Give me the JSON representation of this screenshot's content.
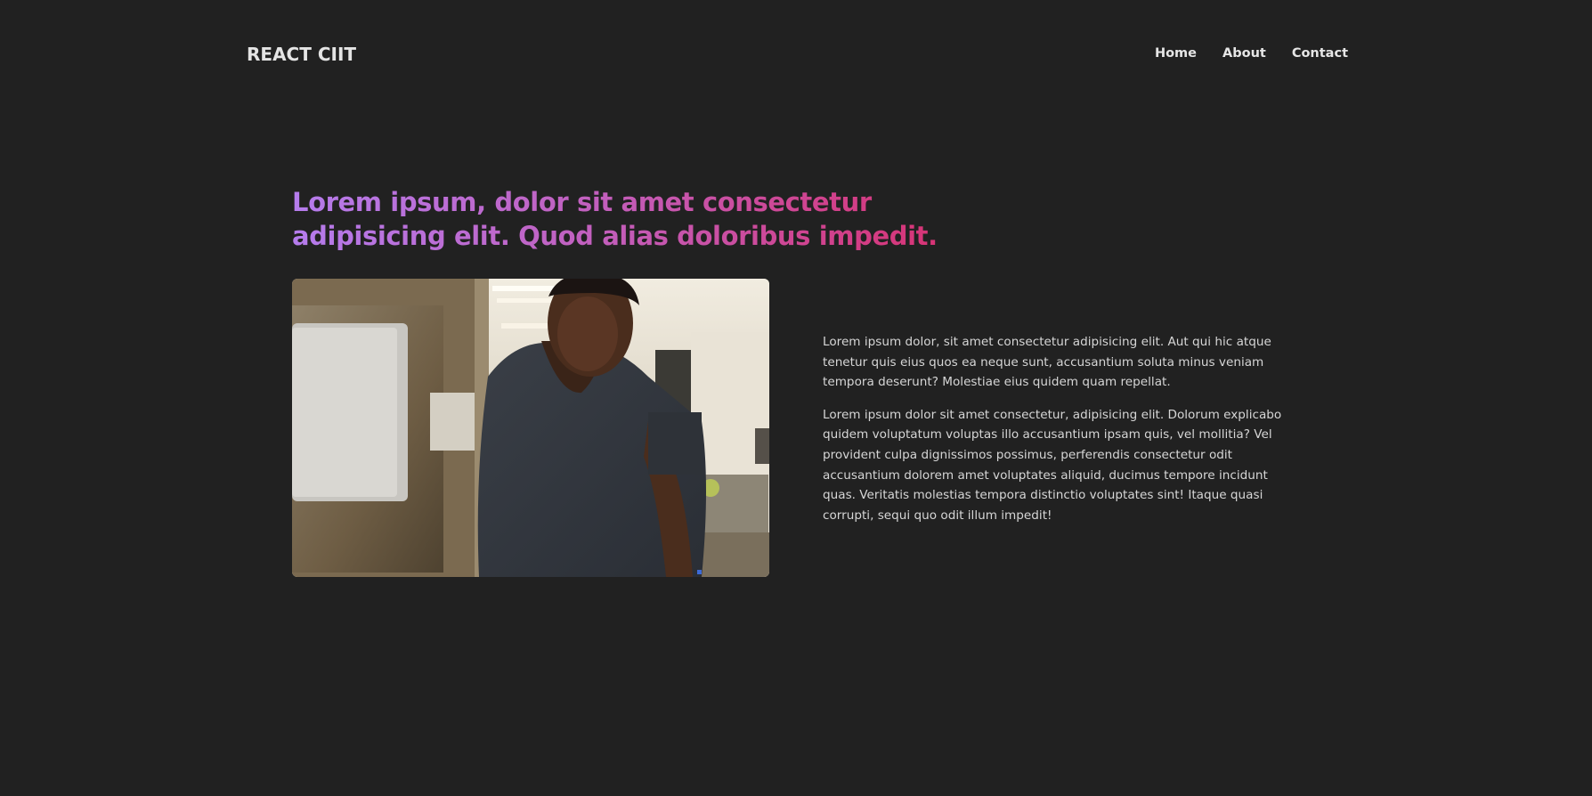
{
  "header": {
    "brand": "REACT CIIT",
    "nav": [
      {
        "label": "Home"
      },
      {
        "label": "About"
      },
      {
        "label": "Contact"
      }
    ]
  },
  "hero": {
    "headline": "Lorem ipsum, dolor sit amet consectetur adipisicing elit. Quod alias doloribus impedit.",
    "gradient": {
      "start": "#b57ced",
      "mid": "#c25fbd",
      "end": "#d9306f"
    }
  },
  "content": {
    "paragraphs": [
      "Lorem ipsum dolor, sit amet consectetur adipisicing elit. Aut qui hic atque tenetur quis eius quos ea neque sunt, accusantium soluta minus veniam tempora deserunt? Molestiae eius quidem quam repellat.",
      "Lorem ipsum dolor sit amet consectetur, adipisicing elit. Dolorum explicabo quidem voluptatum voluptas illo accusantium ipsam quis, vel mollitia? Vel provident culpa dignissimos possimus, perferendis consectetur odit accusantium dolorem amet voluptates aliquid, ducimus tempore incidunt quas. Veritatis molestias tempora distinctio voluptates sint! Itaque quasi corrupti, sequi quo odit illum impedit!"
    ]
  },
  "colors": {
    "background": "#212121",
    "text": "#d6d6d6",
    "nav_text": "#e6e6e6"
  }
}
